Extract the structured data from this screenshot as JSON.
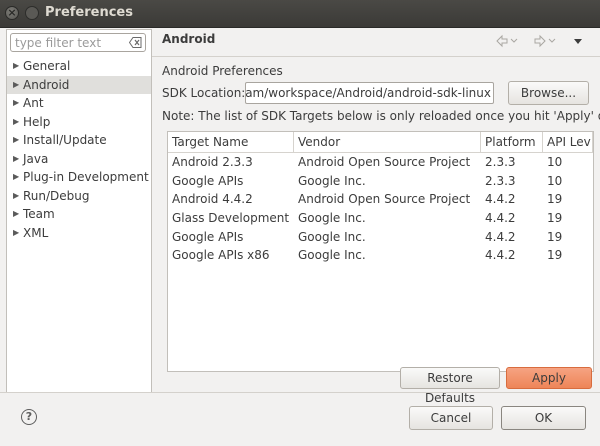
{
  "window": {
    "title": "Preferences"
  },
  "filter": {
    "placeholder": "type filter text"
  },
  "tree": [
    {
      "label": "General",
      "has_children": true
    },
    {
      "label": "Android",
      "has_children": true,
      "selected": true
    },
    {
      "label": "Ant",
      "has_children": true
    },
    {
      "label": "Help",
      "has_children": true
    },
    {
      "label": "Install/Update",
      "has_children": true
    },
    {
      "label": "Java",
      "has_children": true
    },
    {
      "label": "Plug-in Development",
      "has_children": true
    },
    {
      "label": "Run/Debug",
      "has_children": true
    },
    {
      "label": "Team",
      "has_children": true
    },
    {
      "label": "XML",
      "has_children": true
    }
  ],
  "page": {
    "title": "Android",
    "section_label": "Android Preferences",
    "sdk_label": "SDK Location:",
    "sdk_value": "ogram/workspace/Android/android-sdk-linux",
    "browse_label": "Browse...",
    "note": "Note: The list of SDK Targets below is only reloaded once you hit 'Apply' or 'OK'."
  },
  "targets_table": {
    "columns": [
      "Target Name",
      "Vendor",
      "Platform",
      "API Lev"
    ],
    "rows": [
      [
        "Android 2.3.3",
        "Android Open Source Project",
        "2.3.3",
        "10"
      ],
      [
        "Google APIs",
        "Google Inc.",
        "2.3.3",
        "10"
      ],
      [
        "Android 4.4.2",
        "Android Open Source Project",
        "4.4.2",
        "19"
      ],
      [
        "Glass Development Kit",
        "Google Inc.",
        "4.4.2",
        "19"
      ],
      [
        "Google APIs",
        "Google Inc.",
        "4.4.2",
        "19"
      ],
      [
        "Google APIs x86",
        "Google Inc.",
        "4.4.2",
        "19"
      ]
    ]
  },
  "buttons": {
    "restore_defaults": "Restore Defaults",
    "apply": "Apply",
    "cancel": "Cancel",
    "ok": "OK"
  },
  "icons": {
    "back": "arrow-left-icon",
    "forward": "arrow-right-icon",
    "menu": "chevron-down-icon",
    "help": "help-icon",
    "clear": "clear-icon",
    "close": "close-icon"
  },
  "colors": {
    "apply_accent": "#ee8558",
    "titlebar": "#3c3b37"
  }
}
